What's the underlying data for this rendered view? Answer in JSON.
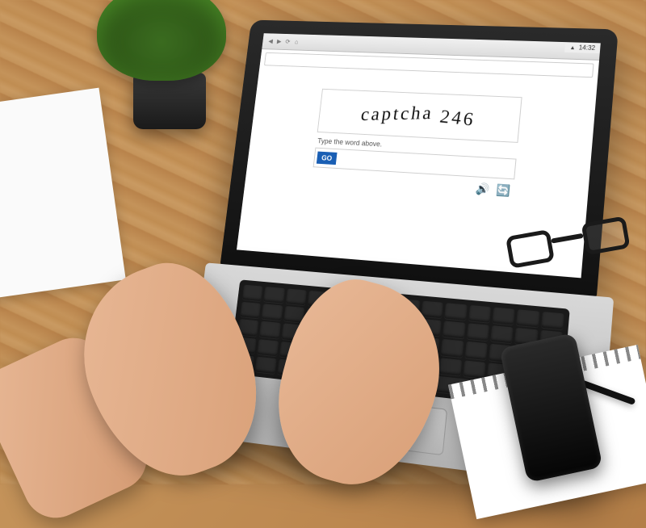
{
  "status_bar": {
    "time": "14:32"
  },
  "captcha": {
    "challenge_word1": "captcha",
    "challenge_word2": "246",
    "instruction": "Type the word above.",
    "go_label": "GO",
    "input_value": "",
    "audio_icon": "audio-icon",
    "refresh_icon": "refresh-icon"
  }
}
